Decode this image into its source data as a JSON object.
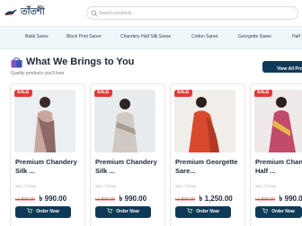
{
  "header": {
    "logo_text": "তাঁতশী",
    "search_placeholder": "Search products..."
  },
  "categories": [
    "Batik Saree",
    "Block Print Saree",
    "Chandery Half Silk Saree",
    "Cotton Saree",
    "Georgette Saree",
    "Half"
  ],
  "section": {
    "title": "What We Brings to You",
    "subtitle": "Quality products you'll love",
    "view_all": "View All Produ"
  },
  "products": [
    {
      "sale": "SALE",
      "title_1": "Premium Chandery",
      "title_2": "Silk ...",
      "sku": "SKU: TS-DG",
      "old_price": "৳1,800.00",
      "new_price": "৳ 990.00",
      "button": "Order Now",
      "swatch": "#c9a7a0"
    },
    {
      "sale": "SALE",
      "title_1": "Premium Chandery",
      "title_2": "Silk ...",
      "sku": "SKU: TS-DG",
      "old_price": "৳1,800.00",
      "new_price": "৳ 990.00",
      "button": "Order Now",
      "swatch": "#cfc9c2"
    },
    {
      "sale": "SALE",
      "title_1": "Premium Georgette",
      "title_2": "Sare...",
      "sku": "SKU: TS-DG",
      "old_price": "৳1,800.00",
      "new_price": "৳ 1,250.00",
      "button": "Order Now",
      "swatch": "#d9492e"
    },
    {
      "sale": "SALE",
      "title_1": "Premium Chandery",
      "title_2": "Half ...",
      "sku": "SKU: TS-DG",
      "old_price": "৳1,800.00",
      "new_price": "৳ 990.00",
      "button": "Order Now",
      "swatch": "#c24a6a"
    }
  ],
  "colors": {
    "primary": "#0f3a57",
    "sale": "#e53935",
    "catbar": "#eef8fb"
  }
}
